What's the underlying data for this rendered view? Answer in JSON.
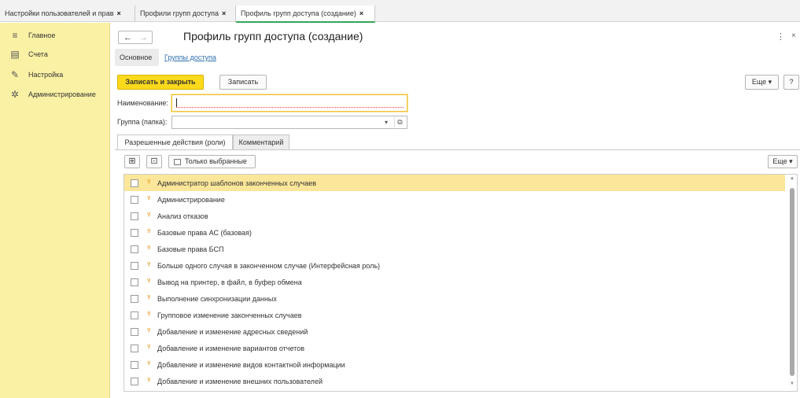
{
  "window_tabs": [
    {
      "label": "Настройки пользователей и прав",
      "close": "×"
    },
    {
      "label": "Профили групп доступа",
      "close": "×"
    },
    {
      "label": "Профиль групп доступа (создание)",
      "close": "×"
    }
  ],
  "sidebar": {
    "items": [
      {
        "label": "Главное",
        "icon": "menu-lines-icon"
      },
      {
        "label": "Счета",
        "icon": "document-icon"
      },
      {
        "label": "Настройка",
        "icon": "wrench-icon"
      },
      {
        "label": "Администрирование",
        "icon": "gear-icon"
      }
    ]
  },
  "header": {
    "title": "Профиль групп доступа (создание)",
    "more_dots": "⋮",
    "close": "×"
  },
  "subtabs": {
    "main": "Основное",
    "groups_link": "Группы доступа"
  },
  "toolbar": {
    "save_close": "Записать и закрыть",
    "save": "Записать",
    "more": "Еще",
    "help": "?"
  },
  "form": {
    "name_label": "Наименование:",
    "name_value": "",
    "group_label": "Группа (папка):",
    "group_value": ""
  },
  "form_tabs": {
    "roles": "Разрешенные действия (роли)",
    "comment": "Комментарий"
  },
  "list_toolbar": {
    "only_selected": "Только выбранные",
    "more": "Еще"
  },
  "roles": [
    {
      "label": "Администратор шаблонов законченных случаев",
      "checked": false
    },
    {
      "label": "Администрирование",
      "checked": false
    },
    {
      "label": "Анализ отказов",
      "checked": false
    },
    {
      "label": "Базовые права АС (базовая)",
      "checked": false
    },
    {
      "label": "Базовые права БСП",
      "checked": false
    },
    {
      "label": "Больше одного случая в законченном случае (Интерфейсная роль)",
      "checked": false
    },
    {
      "label": "Вывод на принтер, в файл, в буфер обмена",
      "checked": false
    },
    {
      "label": "Выполнение синхронизации данных",
      "checked": false
    },
    {
      "label": "Групповое изменение законченных случаев",
      "checked": false
    },
    {
      "label": "Добавление и изменение адресных сведений",
      "checked": false
    },
    {
      "label": "Добавление и изменение вариантов отчетов",
      "checked": false
    },
    {
      "label": "Добавление и изменение видов контактной информации",
      "checked": false
    },
    {
      "label": "Добавление и изменение внешних пользователей",
      "checked": false
    }
  ],
  "colors": {
    "sidebar_bg": "#fbf1a5",
    "primary_button": "#fbd91b",
    "selected_row": "#fbe69a",
    "link": "#2f6fb1",
    "active_tab_underline": "#35a35a"
  }
}
